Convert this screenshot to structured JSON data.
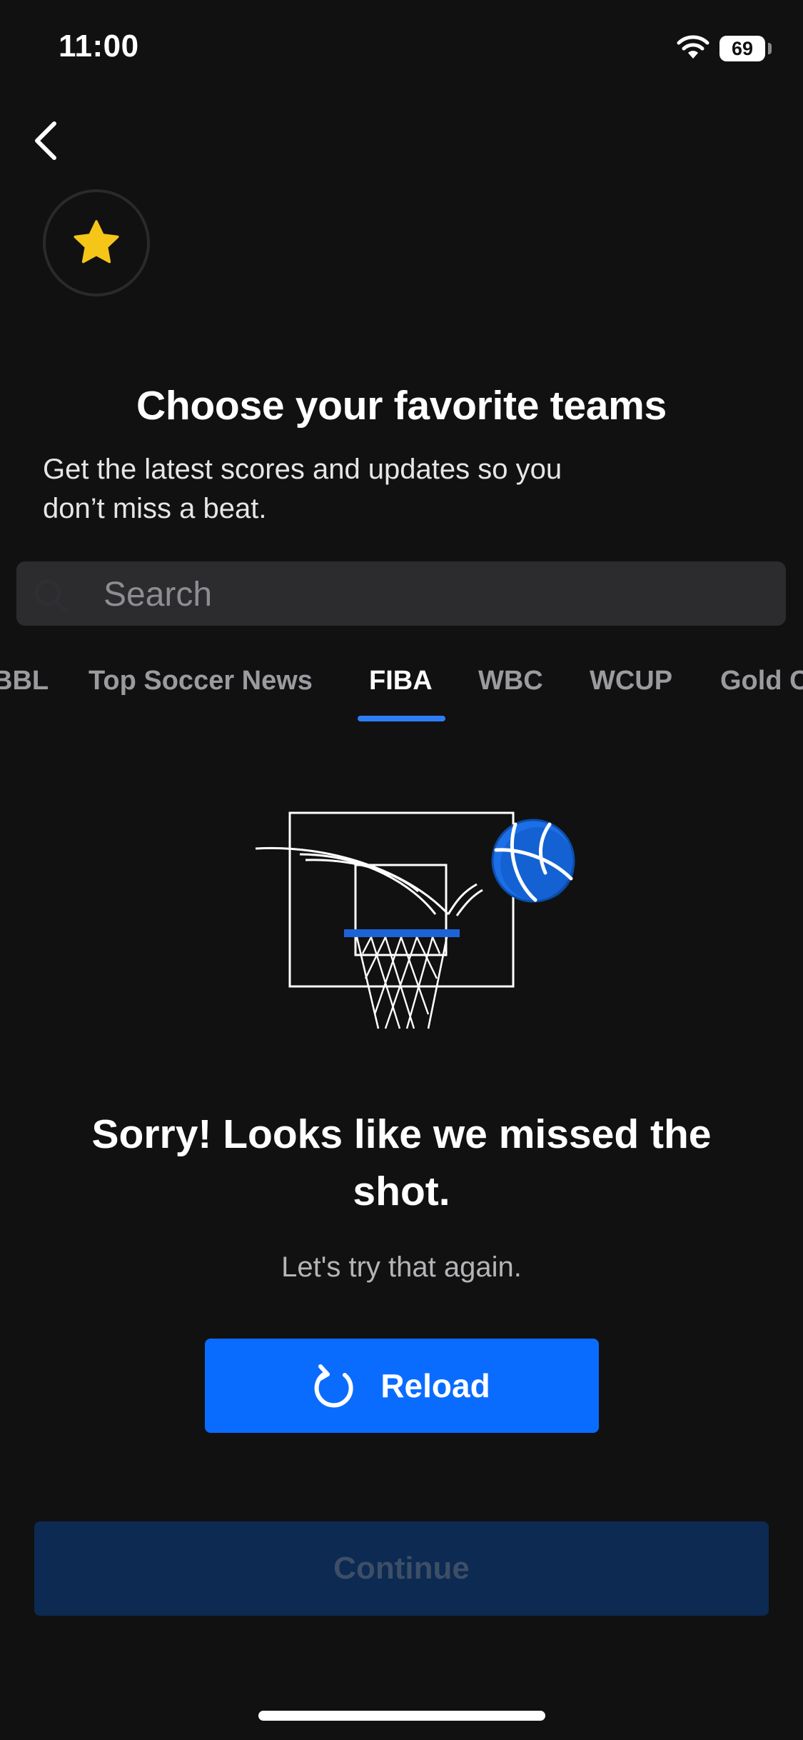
{
  "status_bar": {
    "time": "11:00",
    "battery_level": "69"
  },
  "header": {
    "back_icon": "chevron-left-icon",
    "badge_icon": "star-icon",
    "badge_color": "#F5C518"
  },
  "title": "Choose your favorite teams",
  "subtitle_line1": "Get the latest scores and updates so you",
  "subtitle_line2": "don’t miss a beat.",
  "search": {
    "placeholder": "Search",
    "icon": "search-icon"
  },
  "tabs": [
    {
      "label": "BBL",
      "active": false
    },
    {
      "label": "Top Soccer News",
      "active": false
    },
    {
      "label": "FIBA",
      "active": true
    },
    {
      "label": "WBC",
      "active": false
    },
    {
      "label": "WCUP",
      "active": false
    },
    {
      "label": "Gold Cup",
      "active": false
    }
  ],
  "error": {
    "illustration": "basketball-hoop-icon",
    "title": "Sorry! Looks like we missed the shot.",
    "message": "Let's try that again."
  },
  "reload_button": {
    "label": "Reload",
    "icon": "refresh-icon"
  },
  "continue_button": {
    "label": "Continue"
  },
  "colors": {
    "accent": "#0A6CFF",
    "tab_indicator": "#2F7DF6",
    "background": "#111112",
    "continue_disabled": "#0C2A52"
  }
}
